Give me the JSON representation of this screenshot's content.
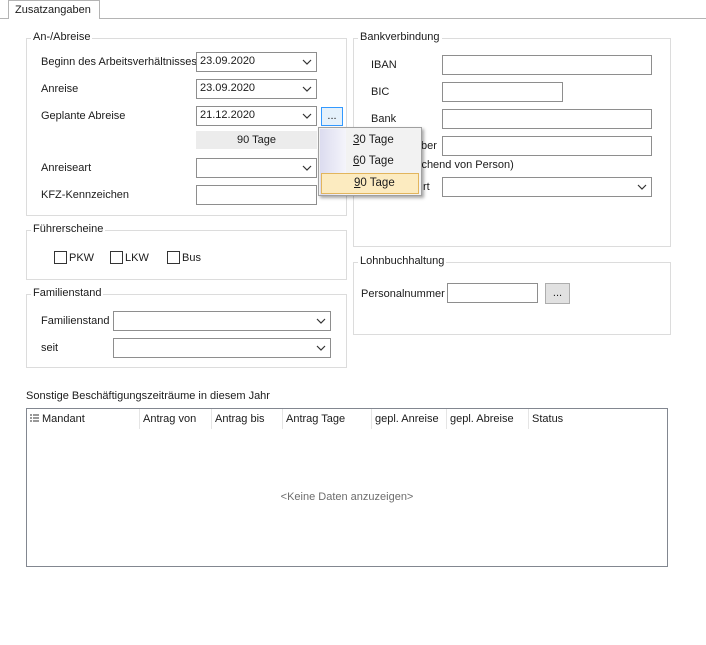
{
  "tabs": [
    {
      "label": "Zusatzangaben"
    }
  ],
  "anabreise": {
    "title": "An-/Abreise",
    "beginn_label": "Beginn des Arbeitsverhältnisses",
    "beginn_value": "23.09.2020",
    "anreise_label": "Anreise",
    "anreise_value": "23.09.2020",
    "abreise_label": "Geplante Abreise",
    "abreise_value": "21.12.2020",
    "dots_label": "...",
    "days_display": "90 Tage",
    "anreiseart_label": "Anreiseart",
    "anreiseart_value": "",
    "kfz_label": "KFZ-Kennzeichen",
    "kfz_value": ""
  },
  "dropdown_menu": {
    "items": [
      {
        "mnemonic": "3",
        "rest": "0 Tage",
        "selected": false
      },
      {
        "mnemonic": "6",
        "rest": "0 Tage",
        "selected": false
      },
      {
        "mnemonic": "9",
        "rest": "0 Tage",
        "selected": true
      }
    ]
  },
  "fuehrerscheine": {
    "title": "Führerscheine",
    "options": [
      {
        "label": "PKW",
        "checked": false
      },
      {
        "label": "LKW",
        "checked": false
      },
      {
        "label": "Bus",
        "checked": false
      }
    ]
  },
  "familienstand": {
    "title": "Familienstand",
    "familienstand_label": "Familienstand",
    "familienstand_value": "",
    "seit_label": "seit",
    "seit_value": ""
  },
  "bankverbindung": {
    "title": "Bankverbindung",
    "iban_label": "IBAN",
    "iban_value": "",
    "bic_label": "BIC",
    "bic_value": "",
    "bank_label": "Bank",
    "bank_value": "",
    "inhaber_label_partial": "ber",
    "inhaber_value": "",
    "abweichend_partial": "ichend von Person)",
    "art_label_partial": "rt",
    "art_value": ""
  },
  "lohnbuchhaltung": {
    "title": "Lohnbuchhaltung",
    "personalnummer_label": "Personalnummer",
    "personalnummer_value": "",
    "dots_label": "..."
  },
  "sonstige": {
    "title": "Sonstige Beschäftigungszeiträume in diesem Jahr",
    "columns": [
      "Mandant",
      "Antrag von",
      "Antrag bis",
      "Antrag Tage",
      "gepl. Anreise",
      "gepl. Abreise",
      "Status"
    ],
    "empty_text": "<Keine Daten anzuzeigen>"
  },
  "colors": {
    "menu_highlight": "#fcebc0",
    "menu_highlight_border": "#e2b55d",
    "active_button_border": "#3399ff"
  }
}
